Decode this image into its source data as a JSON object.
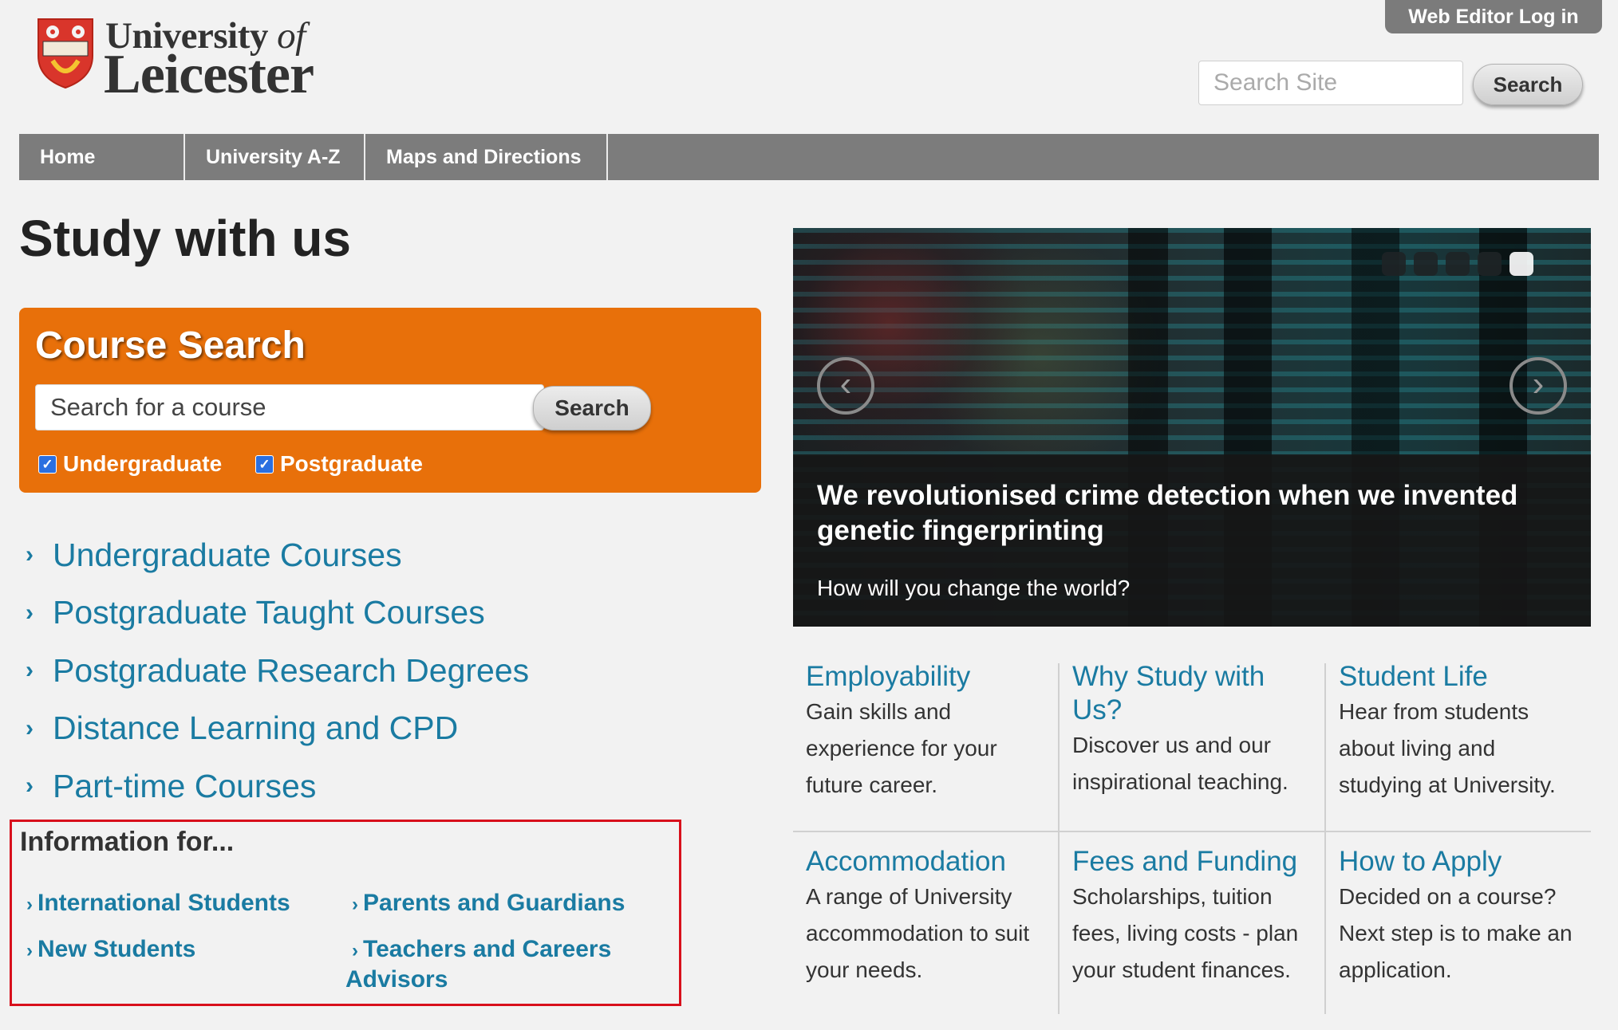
{
  "header": {
    "logo_line1_main": "University ",
    "logo_line1_of": "of",
    "logo_line2": "Leicester",
    "web_editor_label": "Web Editor Log in",
    "search_placeholder": "Search Site",
    "search_button": "Search"
  },
  "nav": {
    "items": [
      {
        "label": "Home"
      },
      {
        "label": "University A-Z"
      },
      {
        "label": "Maps and Directions"
      }
    ]
  },
  "main": {
    "page_title": "Study with us",
    "course_search": {
      "title": "Course Search",
      "placeholder": "Search for a course",
      "button": "Search",
      "checkboxes": [
        {
          "label": "Undergraduate",
          "checked": true
        },
        {
          "label": "Postgraduate",
          "checked": true
        }
      ]
    },
    "course_links": [
      {
        "label": "Undergraduate Courses"
      },
      {
        "label": "Postgraduate Taught Courses"
      },
      {
        "label": "Postgraduate Research Degrees"
      },
      {
        "label": "Distance Learning and CPD"
      },
      {
        "label": "Part-time Courses"
      }
    ],
    "info_for": {
      "title": "Information for...",
      "links": [
        {
          "label": "International Students"
        },
        {
          "label": "Parents and Guardians"
        },
        {
          "label": "New Students"
        },
        {
          "label": "Teachers and Careers Advisors"
        }
      ]
    }
  },
  "slider": {
    "headline": "We revolutionised crime detection when we invented genetic fingerprinting",
    "subtext": "How will you change the world?",
    "prev_glyph": "‹",
    "next_glyph": "›",
    "dot_count": 5,
    "active_dot": 5
  },
  "features": [
    {
      "title": "Employability",
      "desc": "Gain skills and experience for your future career."
    },
    {
      "title": "Why Study with Us?",
      "desc": "Discover us and our inspirational teaching."
    },
    {
      "title": "Student Life",
      "desc": "Hear from students about living and studying at University."
    },
    {
      "title": "Accommodation",
      "desc": "A range of University accommodation to suit your needs."
    },
    {
      "title": "Fees and Funding",
      "desc": "Scholarships, tuition fees, living costs - plan your student finances."
    },
    {
      "title": "How to Apply",
      "desc": "Decided on a course? Next step is to make an application."
    }
  ],
  "colors": {
    "accent_orange": "#e8700a",
    "link_blue": "#1a7ba2",
    "nav_gray": "#7c7c7c",
    "highlight_red": "#d8101c"
  }
}
